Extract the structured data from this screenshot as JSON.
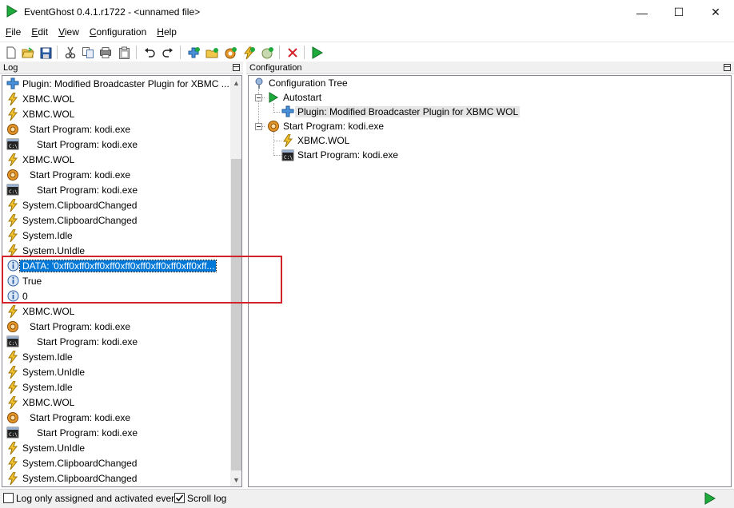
{
  "window": {
    "title": "EventGhost 0.4.1.r1722 - <unnamed file>",
    "minimize_glyph": "—",
    "maximize_glyph": "☐",
    "close_glyph": "✕"
  },
  "menu": [
    {
      "label_u": "F",
      "label_rest": "ile"
    },
    {
      "label_u": "E",
      "label_rest": "dit"
    },
    {
      "label_u": "V",
      "label_rest": "iew"
    },
    {
      "label_u": "C",
      "label_rest": "onfiguration"
    },
    {
      "label_u": "H",
      "label_rest": "elp"
    }
  ],
  "toolbar": {
    "icons": [
      "new-file-icon",
      "open-folder-icon",
      "save-icon",
      "cut-icon",
      "copy-icon",
      "paste-icon",
      "clipboard-icon",
      "undo-icon",
      "redo-icon",
      "add-plugin-icon",
      "add-folder-icon",
      "add-macro-icon",
      "add-event-icon",
      "add-action-icon",
      "delete-icon",
      "execute-icon"
    ]
  },
  "log": {
    "header": "Log",
    "rows": [
      {
        "icon": "plugin-icon",
        "indent": 0,
        "text": "Plugin: Modified Broadcaster Plugin for XBMC ..."
      },
      {
        "icon": "event-icon",
        "indent": 0,
        "text": "XBMC.WOL"
      },
      {
        "icon": "event-icon",
        "indent": 0,
        "text": "XBMC.WOL"
      },
      {
        "icon": "macro-icon",
        "indent": 1,
        "text": "Start Program: kodi.exe"
      },
      {
        "icon": "program-icon",
        "indent": 2,
        "text": "Start Program: kodi.exe"
      },
      {
        "icon": "event-icon",
        "indent": 0,
        "text": "XBMC.WOL"
      },
      {
        "icon": "macro-icon",
        "indent": 1,
        "text": "Start Program: kodi.exe"
      },
      {
        "icon": "program-icon",
        "indent": 2,
        "text": "Start Program: kodi.exe"
      },
      {
        "icon": "event-icon",
        "indent": 0,
        "text": "System.ClipboardChanged"
      },
      {
        "icon": "event-icon",
        "indent": 0,
        "text": "System.ClipboardChanged"
      },
      {
        "icon": "event-icon",
        "indent": 0,
        "text": "System.Idle"
      },
      {
        "icon": "event-icon",
        "indent": 0,
        "text": "System.UnIdle"
      },
      {
        "icon": "info-icon",
        "indent": 0,
        "text": "DATA: '0xff0xff0xff0xff0xff0xff0xff0xff0xff0xff...",
        "selected": true
      },
      {
        "icon": "info-icon",
        "indent": 0,
        "text": "True"
      },
      {
        "icon": "info-icon",
        "indent": 0,
        "text": "0"
      },
      {
        "icon": "event-icon",
        "indent": 0,
        "text": "XBMC.WOL"
      },
      {
        "icon": "macro-icon",
        "indent": 1,
        "text": "Start Program: kodi.exe"
      },
      {
        "icon": "program-icon",
        "indent": 2,
        "text": "Start Program: kodi.exe"
      },
      {
        "icon": "event-icon",
        "indent": 0,
        "text": "System.Idle"
      },
      {
        "icon": "event-icon",
        "indent": 0,
        "text": "System.UnIdle"
      },
      {
        "icon": "event-icon",
        "indent": 0,
        "text": "System.Idle"
      },
      {
        "icon": "event-icon",
        "indent": 0,
        "text": "XBMC.WOL"
      },
      {
        "icon": "macro-icon",
        "indent": 1,
        "text": "Start Program: kodi.exe"
      },
      {
        "icon": "program-icon",
        "indent": 2,
        "text": "Start Program: kodi.exe"
      },
      {
        "icon": "event-icon",
        "indent": 0,
        "text": "System.UnIdle"
      },
      {
        "icon": "event-icon",
        "indent": 0,
        "text": "System.ClipboardChanged"
      },
      {
        "icon": "event-icon",
        "indent": 0,
        "text": "System.ClipboardChanged"
      }
    ]
  },
  "config": {
    "header": "Configuration",
    "tree_root": "Configuration Tree",
    "autostart": "Autostart",
    "autostart_plugin": "Plugin: Modified Broadcaster Plugin for XBMC WOL",
    "macro": "Start Program: kodi.exe",
    "macro_event": "XBMC.WOL",
    "macro_action": "Start Program: kodi.exe"
  },
  "status": {
    "log_only_assigned": "Log only assigned and activated events",
    "log_only_assigned_checked": false,
    "scroll_log": "Scroll log",
    "scroll_log_checked": true
  },
  "colors": {
    "selection": "#0078d7",
    "annotation": "#d2232a",
    "play_green": "#1faa3c"
  }
}
